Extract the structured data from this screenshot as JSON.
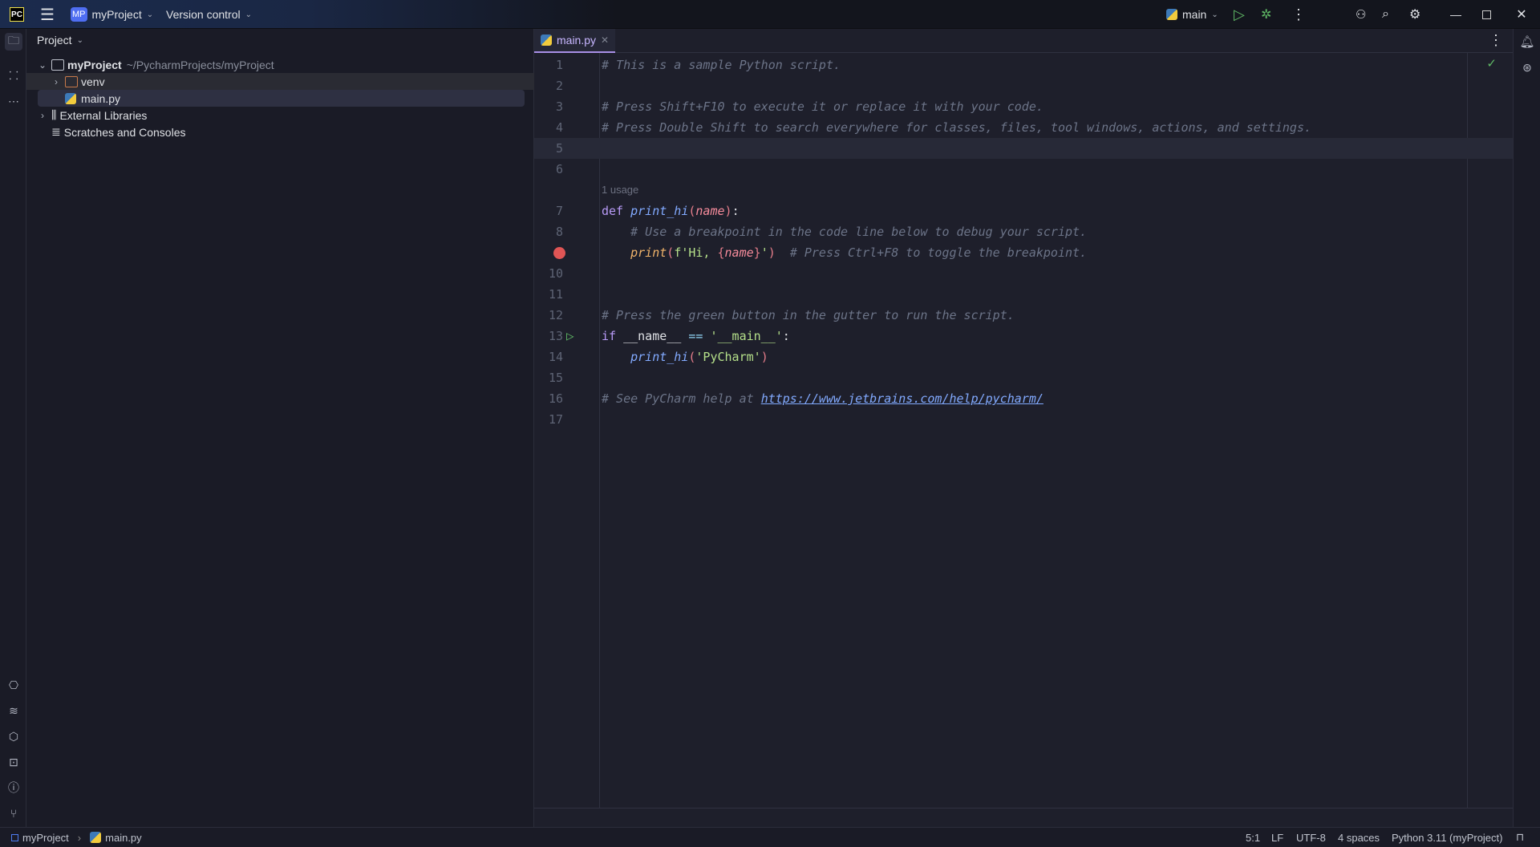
{
  "titlebar": {
    "app_logo": "PC",
    "menu_icon": "hamburger-icon",
    "project_badge": "MP",
    "project_name": "myProject",
    "vcs": "Version control",
    "run_config": "main",
    "window_controls": [
      "minimize",
      "maximize",
      "close"
    ]
  },
  "left_toolbar": {
    "top": [
      "folder-icon",
      "structure-icon",
      "more-icon"
    ],
    "bottom": [
      "python-console-icon",
      "layers-icon",
      "services-icon",
      "terminal-icon",
      "problems-icon",
      "git-icon"
    ]
  },
  "project_panel": {
    "title": "Project",
    "tree": [
      {
        "label": "myProject",
        "path": "~/PycharmProjects/myProject",
        "expanded": true,
        "type": "folder"
      },
      {
        "label": "venv",
        "type": "excluded-folder",
        "expanded": false
      },
      {
        "label": "main.py",
        "type": "python-file",
        "selected": true
      },
      {
        "label": "External Libraries",
        "type": "library",
        "expanded": false
      },
      {
        "label": "Scratches and Consoles",
        "type": "scratches"
      }
    ]
  },
  "editor": {
    "tab": "main.py",
    "usage_hint": "1 usage",
    "lines": [
      "# This is a sample Python script.",
      "",
      "# Press Shift+F10 to execute it or replace it with your code.",
      "# Press Double Shift to search everywhere for classes, files, tool windows, actions, and settings.",
      "",
      "",
      "def print_hi(name):",
      "    # Use a breakpoint in the code line below to debug your script.",
      "    print(f'Hi, {name}')  # Press Ctrl+F8 to toggle the breakpoint.",
      "",
      "",
      "# Press the green button in the gutter to run the script.",
      "if __name__ == '__main__':",
      "    print_hi('PyCharm')",
      "",
      "# See PyCharm help at https://www.jetbrains.com/help/pycharm/",
      ""
    ],
    "link": "https://www.jetbrains.com/help/pycharm/",
    "breakpoint_line": 9,
    "run_gutter_line": 13,
    "current_line": 5
  },
  "statusbar": {
    "breadcrumb": [
      "myProject",
      "main.py"
    ],
    "position": "5:1",
    "line_sep": "LF",
    "encoding": "UTF-8",
    "indent": "4 spaces",
    "interpreter": "Python 3.11 (myProject)"
  },
  "colors": {
    "accent": "#a98fe6",
    "run": "#5fb865",
    "breakpoint": "#e05555"
  }
}
